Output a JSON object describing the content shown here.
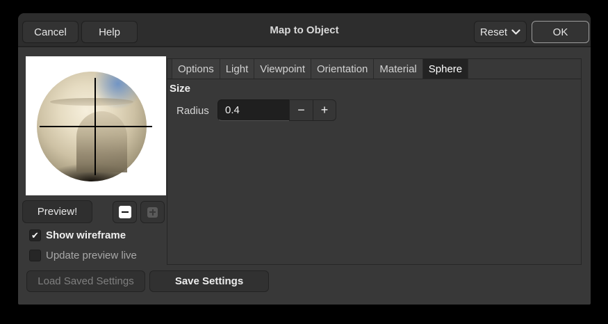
{
  "title": "Map to Object",
  "header": {
    "cancel_label": "Cancel",
    "help_label": "Help",
    "reset_label": "Reset",
    "ok_label": "OK"
  },
  "tabs": [
    {
      "label": "Options"
    },
    {
      "label": "Light"
    },
    {
      "label": "Viewpoint"
    },
    {
      "label": "Orientation"
    },
    {
      "label": "Material"
    },
    {
      "label": "Sphere"
    }
  ],
  "active_tab": "Sphere",
  "sphere_panel": {
    "section_title": "Size",
    "radius_label": "Radius",
    "radius_value": "0.4"
  },
  "preview_panel": {
    "preview_button_label": "Preview!",
    "show_wireframe_label": "Show wireframe",
    "show_wireframe_checked": true,
    "update_preview_label": "Update preview live",
    "update_preview_checked": false
  },
  "footer": {
    "load_settings_label": "Load Saved Settings",
    "load_settings_enabled": false,
    "save_settings_label": "Save Settings"
  },
  "icons": {
    "checkmark": "✔",
    "minus": "−",
    "plus": "+"
  },
  "colors": {
    "window_bg": "#383838",
    "header_bg": "#2d2d2d",
    "active_tab_bg": "#232323",
    "entry_bg": "#1f1f1f",
    "text": "#e6e6e6"
  }
}
